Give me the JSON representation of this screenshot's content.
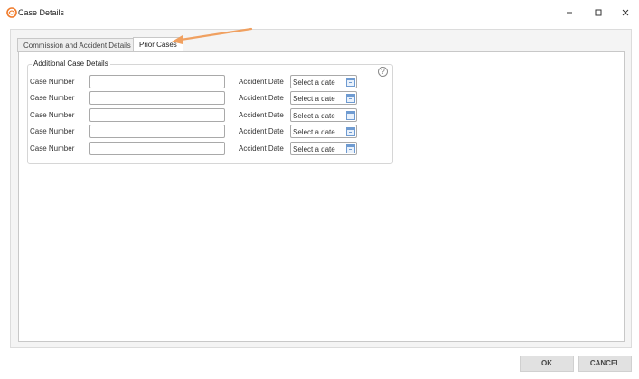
{
  "window": {
    "title": "Case Details",
    "minimize_icon": "minimize-icon",
    "maximize_icon": "maximize-icon",
    "close_icon": "close-icon",
    "app_icon_color": "#f07a2a"
  },
  "tabs": [
    {
      "label": "Commission and Accident Details",
      "active": false
    },
    {
      "label": "Prior Cases",
      "active": true
    }
  ],
  "group": {
    "legend": "Additional Case Details",
    "help_icon": "?"
  },
  "rows": [
    {
      "case_label": "Case Number",
      "case_value": "",
      "date_label": "Accident Date",
      "date_placeholder": "Select a date"
    },
    {
      "case_label": "Case Number",
      "case_value": "",
      "date_label": "Accident Date",
      "date_placeholder": "Select a date"
    },
    {
      "case_label": "Case Number",
      "case_value": "",
      "date_label": "Accident Date",
      "date_placeholder": "Select a date"
    },
    {
      "case_label": "Case Number",
      "case_value": "",
      "date_label": "Accident Date",
      "date_placeholder": "Select a date"
    },
    {
      "case_label": "Case Number",
      "case_value": "",
      "date_label": "Accident Date",
      "date_placeholder": "Select a date"
    }
  ],
  "buttons": {
    "ok": "OK",
    "cancel": "CANCEL"
  },
  "colors": {
    "annotation_arrow": "#f0a060",
    "calendar_icon": "#6f9bd1"
  }
}
